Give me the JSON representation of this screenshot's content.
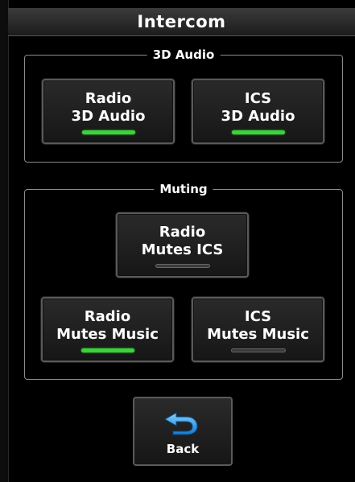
{
  "header": {
    "title": "Intercom"
  },
  "audio_group": {
    "label": "3D Audio",
    "buttons": [
      {
        "line1": "Radio",
        "line2": "3D Audio",
        "active": true
      },
      {
        "line1": "ICS",
        "line2": "3D Audio",
        "active": true
      }
    ]
  },
  "muting_group": {
    "label": "Muting",
    "buttons": [
      {
        "line1": "Radio",
        "line2": "Mutes ICS",
        "active": false
      },
      {
        "line1": "Radio",
        "line2": "Mutes Music",
        "active": true
      },
      {
        "line1": "ICS",
        "line2": "Mutes Music",
        "active": false
      }
    ]
  },
  "back": {
    "label": "Back",
    "icon": "back-arrow-icon"
  },
  "colors": {
    "indicator_on": "#3cd23c",
    "indicator_off": "#3a3a3a",
    "background": "#000000"
  }
}
